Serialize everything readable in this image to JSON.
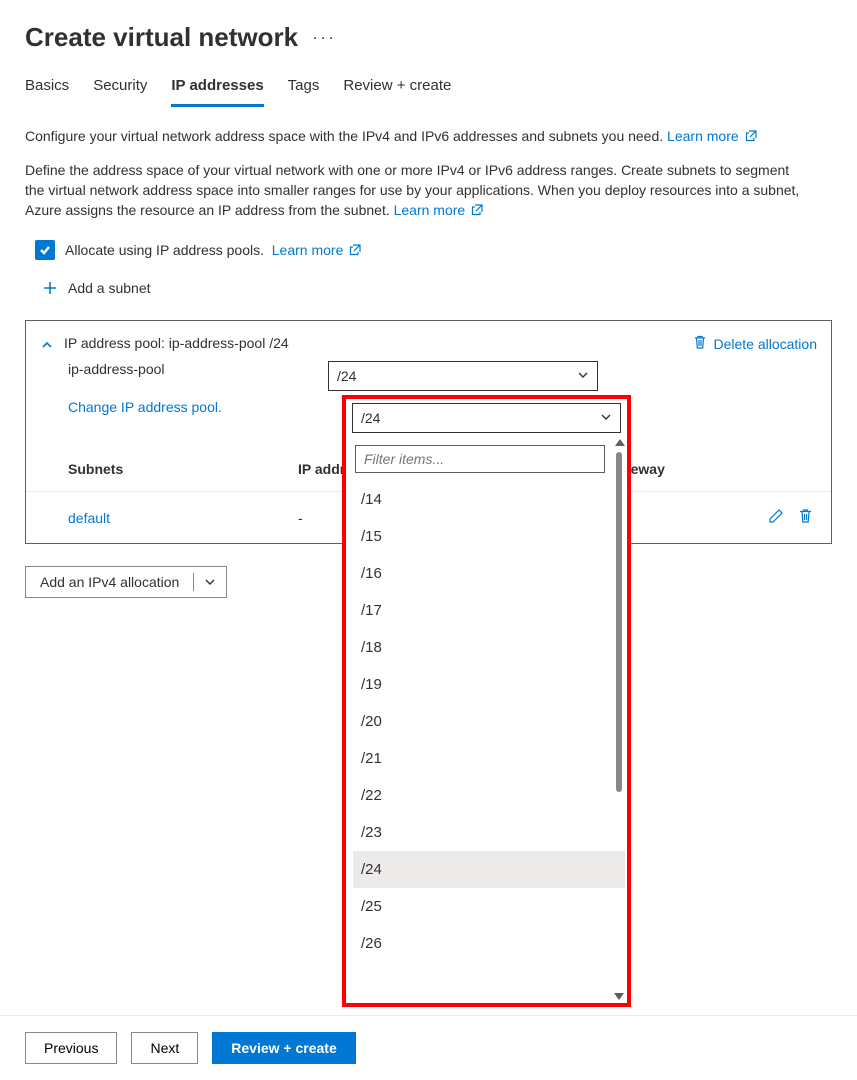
{
  "page_title": "Create virtual network",
  "tabs": [
    "Basics",
    "Security",
    "IP addresses",
    "Tags",
    "Review + create"
  ],
  "active_tab_index": 2,
  "intro_line": "Configure your virtual network address space with the IPv4 and IPv6 addresses and subnets you need.",
  "learn_more": "Learn more",
  "paragraph": "Define the address space of your virtual network with one or more IPv4 or IPv6 address ranges. Create subnets to segment the virtual network address space into smaller ranges for use by your applications. When you deploy resources into a subnet, Azure assigns the resource an IP address from the subnet.",
  "allocate_label": "Allocate using IP address pools.",
  "add_subnet_label": "Add a subnet",
  "pool_header": "IP address pool: ip-address-pool /24",
  "pool_name": "ip-address-pool",
  "prefix_selected": "/24",
  "change_pool_link": "Change IP address pool.",
  "delete_allocation": "Delete allocation",
  "table": {
    "headers": {
      "subnets": "Subnets",
      "ip_range": "IP address range",
      "nat": "NAT gateway"
    },
    "rows": [
      {
        "name": "default",
        "ip_range": "-",
        "nat": ""
      }
    ]
  },
  "add_ipv4_button": "Add an IPv4 allocation",
  "dropdown": {
    "selected": "/24",
    "filter_placeholder": "Filter items...",
    "options": [
      "/14",
      "/15",
      "/16",
      "/17",
      "/18",
      "/19",
      "/20",
      "/21",
      "/22",
      "/23",
      "/24",
      "/25",
      "/26"
    ]
  },
  "footer": {
    "previous": "Previous",
    "next": "Next",
    "review": "Review + create"
  }
}
